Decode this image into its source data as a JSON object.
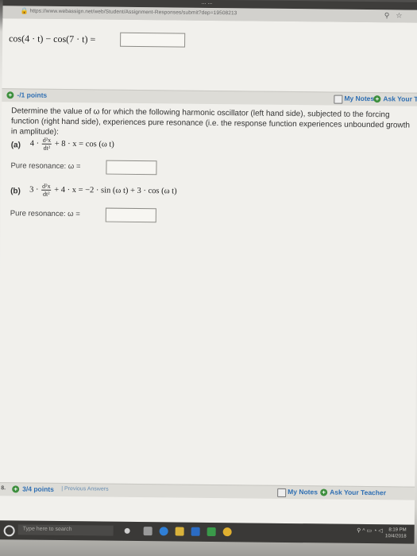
{
  "browser": {
    "tab_title": "... ...",
    "url": "https://www.webassign.net/web/Student/Assignment-Responses/submit?dep=19508213"
  },
  "previous_question": {
    "expression": "cos(4 · t) − cos(7 · t) ="
  },
  "question": {
    "points": "-/1 points",
    "my_notes": "My Notes",
    "ask_teacher": "Ask Your Teac",
    "prompt": "Determine the value of ω for which the following harmonic oscillator (left hand side), subjected to the forcing function (right hand side), experiences pure resonance (i.e. the response function experiences unbounded growth in amplitude):",
    "part_a": {
      "label": "(a)",
      "lhs_coeff": "4 ·",
      "frac_num": "d²x",
      "frac_den": "dt²",
      "rest": "+ 8 · x = cos (ω t)",
      "resonance_label": "Pure resonance:  ω ="
    },
    "part_b": {
      "label": "(b)",
      "lhs_coeff": "3 ·",
      "frac_num": "d²x",
      "frac_den": "dt²",
      "rest": "+ 4 · x = −2 · sin (ω t) + 3 · cos (ω t)",
      "resonance_label": "Pure resonance:  ω ="
    }
  },
  "next_question": {
    "number": "8.",
    "points": "3/4 points",
    "previous_answers": "| Previous Answers",
    "my_notes": "My Notes",
    "ask_teacher": "Ask Your Teacher"
  },
  "taskbar": {
    "search_placeholder": "Type here to search",
    "time": "8:19 PM",
    "date": "10/4/2018"
  },
  "colors": {
    "link_blue": "#2f6fb3",
    "plus_green": "#3e8f3e",
    "header_gray": "#dddcd7"
  }
}
